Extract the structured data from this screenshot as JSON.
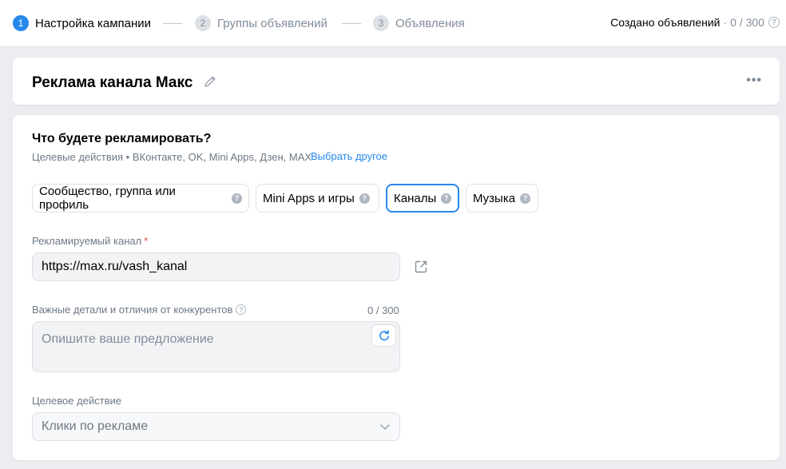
{
  "stepper": {
    "steps": [
      {
        "num": "1",
        "label": "Настройка кампании"
      },
      {
        "num": "2",
        "label": "Группы объявлений"
      },
      {
        "num": "3",
        "label": "Объявления"
      }
    ],
    "counter_label": "Создано объявлений",
    "counter_sep": "·",
    "counter_value": "0 / 300"
  },
  "campaign": {
    "title": "Реклама канала Макс"
  },
  "objective": {
    "title": "Что будете рекламировать?",
    "subtitle": "Целевые действия • ВКонтакте, OK, Mini Apps, Дзен, MAX",
    "link": "Выбрать другое",
    "chips": [
      {
        "label": "Сообщество, группа или профиль"
      },
      {
        "label": "Mini Apps и игры"
      },
      {
        "label": "Каналы",
        "selected": true
      },
      {
        "label": "Музыка"
      }
    ]
  },
  "form": {
    "channel_label": "Рекламируемый канал",
    "channel_required": "*",
    "channel_value": "https://max.ru/vash_kanal",
    "details_label": "Важные детали и отличия от конкурентов",
    "details_counter": "0 / 300",
    "details_placeholder": "Опишите ваше предложение",
    "action_label": "Целевое действие",
    "action_value": "Клики по рекламе"
  },
  "colors": {
    "accent": "#2688eb",
    "required": "#e64646"
  }
}
